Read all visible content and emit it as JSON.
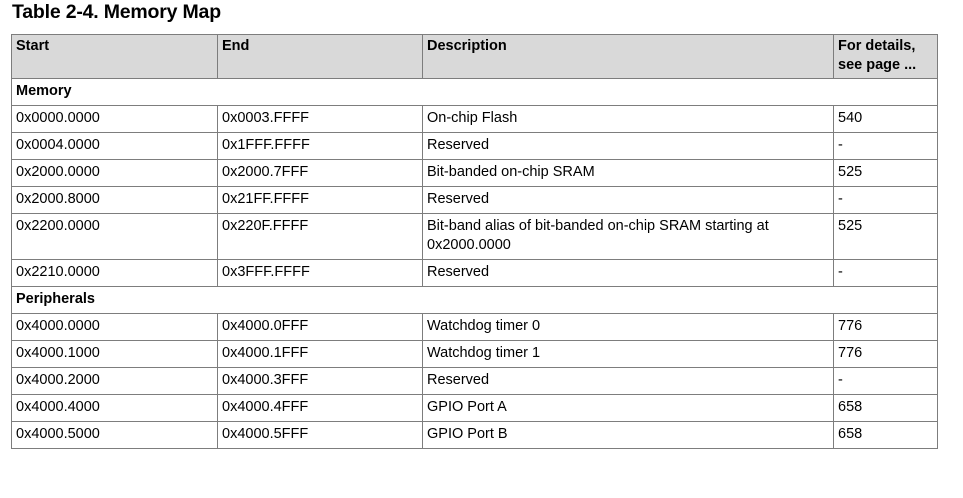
{
  "title": "Table 2-4. Memory Map",
  "table": {
    "headers": {
      "start": "Start",
      "end": "End",
      "description": "Description",
      "details": "For details, see page ..."
    },
    "sections": [
      {
        "label": "Memory",
        "rows": [
          {
            "start": "0x0000.0000",
            "end": "0x0003.FFFF",
            "description": "On-chip Flash",
            "page": "540"
          },
          {
            "start": "0x0004.0000",
            "end": "0x1FFF.FFFF",
            "description": "Reserved",
            "page": "-"
          },
          {
            "start": "0x2000.0000",
            "end": "0x2000.7FFF",
            "description": "Bit-banded on-chip SRAM",
            "page": "525"
          },
          {
            "start": "0x2000.8000",
            "end": "0x21FF.FFFF",
            "description": "Reserved",
            "page": "-"
          },
          {
            "start": "0x2200.0000",
            "end": "0x220F.FFFF",
            "description": "Bit-band alias of bit-banded on-chip SRAM starting at 0x2000.0000",
            "page": "525"
          },
          {
            "start": "0x2210.0000",
            "end": "0x3FFF.FFFF",
            "description": "Reserved",
            "page": "-"
          }
        ]
      },
      {
        "label": "Peripherals",
        "rows": [
          {
            "start": "0x4000.0000",
            "end": "0x4000.0FFF",
            "description": "Watchdog timer 0",
            "page": "776"
          },
          {
            "start": "0x4000.1000",
            "end": "0x4000.1FFF",
            "description": "Watchdog timer 1",
            "page": "776"
          },
          {
            "start": "0x4000.2000",
            "end": "0x4000.3FFF",
            "description": "Reserved",
            "page": "-"
          },
          {
            "start": "0x4000.4000",
            "end": "0x4000.4FFF",
            "description": "GPIO Port A",
            "page": "658"
          },
          {
            "start": "0x4000.5000",
            "end": "0x4000.5FFF",
            "description": "GPIO Port B",
            "page": "658"
          }
        ]
      }
    ]
  }
}
